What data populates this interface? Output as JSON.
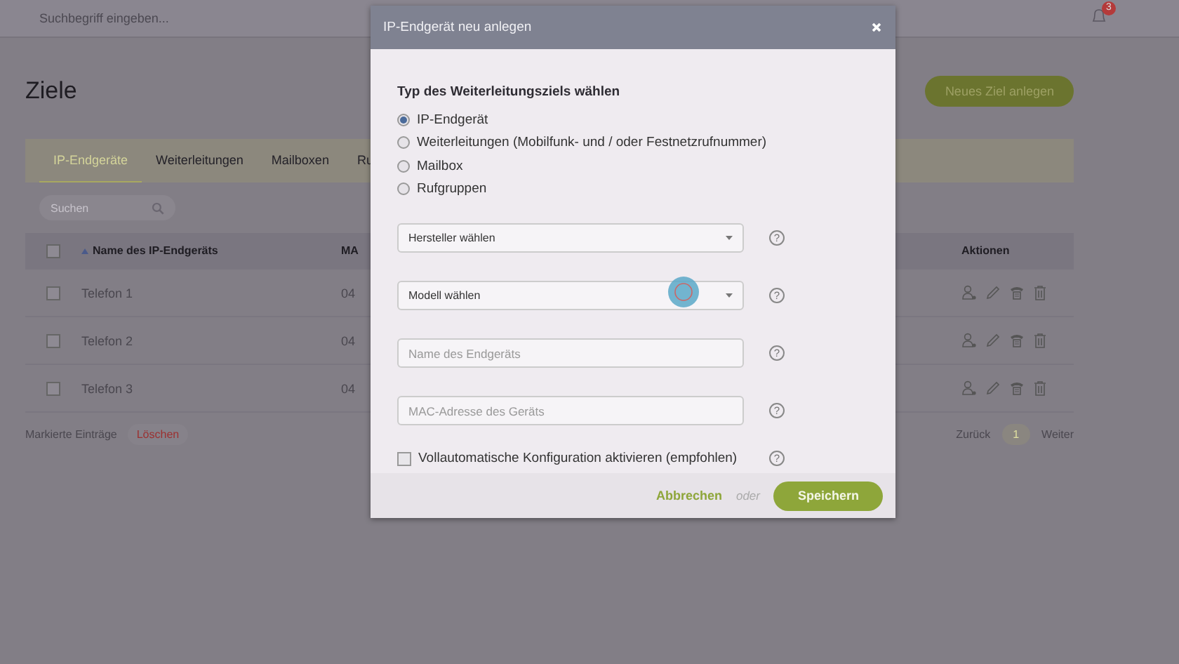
{
  "topbar": {
    "search_placeholder": "Suchbegriff eingeben...",
    "notification_count": "3"
  },
  "page": {
    "title": "Ziele",
    "new_button": "Neues Ziel anlegen",
    "tabs": [
      {
        "label": "IP-Endgeräte",
        "selected": true
      },
      {
        "label": "Weiterleitungen",
        "selected": false
      },
      {
        "label": "Mailboxen",
        "selected": false
      },
      {
        "label": "Ru",
        "selected": false
      }
    ],
    "search": {
      "placeholder": "Suchen"
    },
    "table": {
      "columns": [
        "Name des IP-Endgeräts",
        "MA",
        "Aktionen"
      ],
      "all_checked": false,
      "rows": [
        {
          "name": "Telefon 1",
          "column_2": "04",
          "checked": false
        },
        {
          "name": "Telefon 2",
          "column_2": "04",
          "checked": false
        },
        {
          "name": "Telefon 3",
          "column_2": "04",
          "checked": false
        }
      ]
    },
    "footer": {
      "marked_label": "Markierte Einträge",
      "delete_button": "Löschen",
      "prev": "Zurück",
      "page": "1",
      "next": "Weiter"
    }
  },
  "dialog": {
    "title": "IP-Endgerät neu anlegen",
    "heading": "Typ des Weiterleitungsziels wählen",
    "options": [
      {
        "label": "IP-Endgerät",
        "selected": true
      },
      {
        "label": "Weiterleitungen (Mobilfunk- und / oder Festnetzrufnummer)",
        "selected": false
      },
      {
        "label": "Mailbox",
        "selected": false
      },
      {
        "label": "Rufgruppen",
        "selected": false
      }
    ],
    "fields": [
      {
        "kind": "select",
        "placeholder": "Hersteller wählen",
        "help": "?"
      },
      {
        "kind": "select",
        "placeholder": "Modell wählen",
        "help": "?"
      },
      {
        "kind": "input",
        "placeholder": "Name des Endgeräts",
        "help": "?"
      },
      {
        "kind": "input",
        "placeholder": "MAC-Adresse des Geräts",
        "help": "?"
      }
    ],
    "auto_config": {
      "label": "Vollautomatische Konfiguration aktivieren (empfohlen)",
      "checked": false,
      "help": "?"
    },
    "cancel": "Abbrechen",
    "or": "oder",
    "save": "Speichern"
  }
}
